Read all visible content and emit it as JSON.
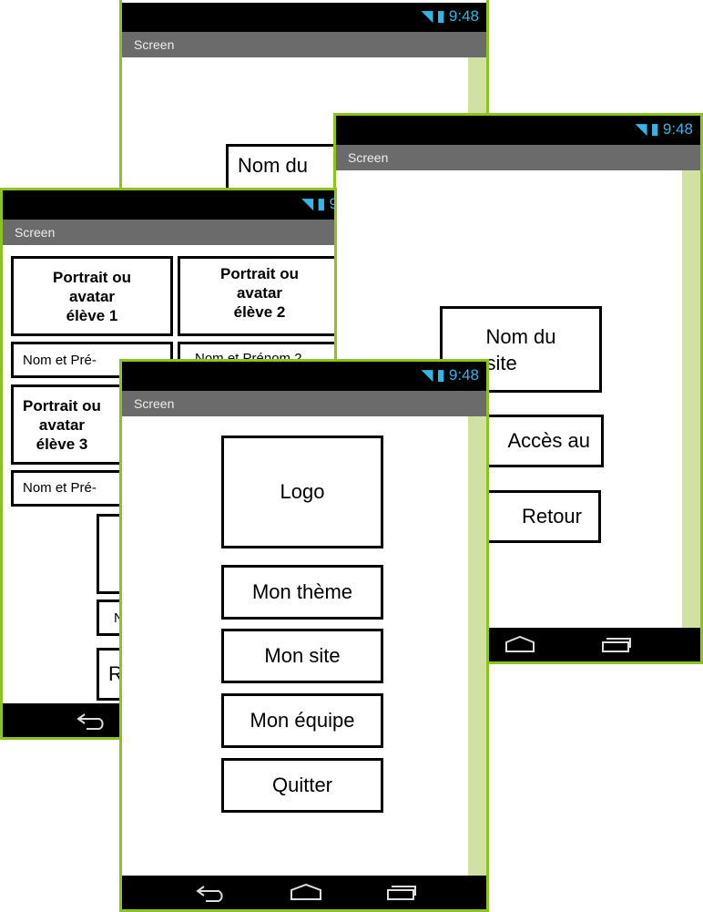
{
  "colors": {
    "frame": "#8dc21f",
    "titlebar": "#6b6b6b",
    "scrollbar": "#d1e0a3",
    "status_icons": "#33b5e5"
  },
  "status": {
    "time": "9:48",
    "icons": [
      "wifi-icon",
      "signal-icon",
      "battery-charging-icon"
    ]
  },
  "phone_a": {
    "title": "Screen",
    "boxes": [
      "Nom du"
    ]
  },
  "phone_b": {
    "title": "Screen",
    "boxes": [
      "Nom du\n   site",
      "Accès au",
      "Retour"
    ]
  },
  "phone_c": {
    "title": "Screen",
    "boxes": [
      "Portrait ou\navatar\nélève 1",
      "Portrait ou\navatar\nélève 2",
      "Nom et Pré-",
      "Nom et Prénom 2",
      "Portrait ou\navatar\nélève 3",
      "Nom et Pré-",
      "",
      "N",
      "R"
    ],
    "status_time": "9"
  },
  "phone_d": {
    "title": "Screen",
    "logo": "Logo",
    "buttons": [
      "Mon thème",
      "Mon site",
      "Mon équipe",
      "Quitter"
    ]
  }
}
